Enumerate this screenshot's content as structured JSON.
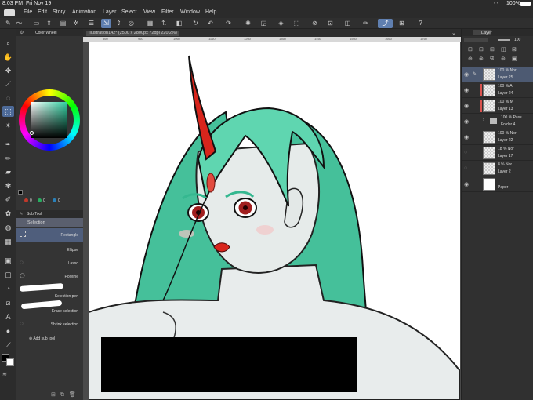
{
  "status": {
    "time": "8:03 PM",
    "date": "Fri Nov 19",
    "battery": "100%"
  },
  "menu": [
    "File",
    "Edit",
    "Story",
    "Animation",
    "Layer",
    "Select",
    "View",
    "Filter",
    "Window",
    "Help"
  ],
  "palette": {
    "color_wheel_title": "Color Wheel",
    "color_values": [
      "0",
      "0",
      "0"
    ],
    "subtool_tab": "Sub Tool",
    "selection_group": "Selection",
    "subtools": [
      "Rectangle",
      "Ellipse",
      "Lasso",
      "Polyline",
      "Selection pen",
      "Erase selection",
      "Shrink selection"
    ],
    "add_subtool": "Add sub tool"
  },
  "document": {
    "tab": "Illustration142* (2500 x 2800px 72dpi 220.2%)"
  },
  "ruler_ticks": [
    "860",
    "960",
    "1060",
    "1160",
    "1260",
    "1360",
    "1460",
    "1560",
    "1660",
    "1760"
  ],
  "layers": {
    "tab": "Layer",
    "opacity": "100",
    "items": [
      {
        "mode": "100 % Nor",
        "name": "Layer 25",
        "selected": true
      },
      {
        "mode": "100 % A",
        "name": "Layer 24",
        "selected": false
      },
      {
        "mode": "100 % M",
        "name": "Layer 13",
        "selected": false
      },
      {
        "mode": "100 % Pass",
        "name": "Folder 4",
        "selected": false
      },
      {
        "mode": "100 % Nor",
        "name": "Layer 22",
        "selected": false
      },
      {
        "mode": "18 % Nor",
        "name": "Layer 17",
        "selected": false
      },
      {
        "mode": "8 % Nor",
        "name": "Layer 2",
        "selected": false
      },
      {
        "mode": "",
        "name": "Paper",
        "selected": false
      }
    ]
  },
  "colors": {
    "accent": "#5f7fb0",
    "hair": "#5fd6b0",
    "horn": "#d8251c",
    "redaction": "#000000"
  }
}
